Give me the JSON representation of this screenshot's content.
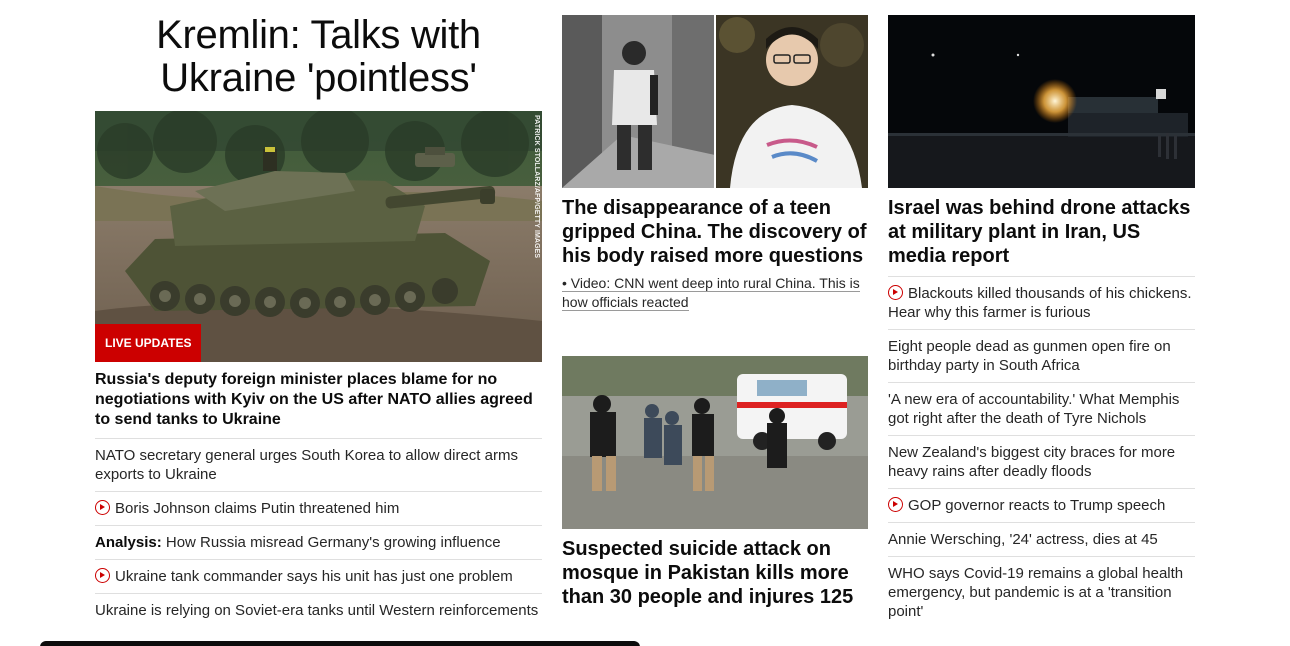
{
  "main": {
    "headline": "Kremlin: Talks with Ukraine 'pointless'",
    "badge": "LIVE UPDATES",
    "photo_credit": "PATRICK STOLLARZ/AFP/GETTY IMAGES",
    "lead": "Russia's deputy foreign minister places blame for no negotiations with Kyiv on the US after NATO allies agreed to send tanks to Ukraine",
    "items": [
      {
        "text": "NATO secretary general urges South Korea to allow direct arms exports to Ukraine"
      },
      {
        "text": "Boris Johnson claims Putin threatened him",
        "icon": "play-icon"
      },
      {
        "prefix": "Analysis:",
        "text": " How Russia misread Germany's growing influence"
      },
      {
        "text": "Ukraine tank commander says his unit has just one problem",
        "icon": "play-icon"
      },
      {
        "text": "Ukraine is relying on Soviet-era tanks until Western reinforcements"
      }
    ]
  },
  "center": {
    "story1_title": "The disappearance of a teen gripped China. The discovery of his body raised more questions",
    "story1_link": "• Video: CNN went deep into rural China. This is how officials reacted",
    "story2_title": "Suspected suicide attack on mosque in Pakistan kills more than 30 people and injures 125"
  },
  "right": {
    "title": "Israel was behind drone attacks at military plant in Iran, US media report",
    "items": [
      {
        "text": "Blackouts killed thousands of his chickens. Hear why this farmer is furious",
        "icon": "play-icon"
      },
      {
        "text": "Eight people dead as gunmen open fire on birthday party in South Africa"
      },
      {
        "text": "'A new era of accountability.' What Memphis got right after the death of Tyre Nichols"
      },
      {
        "text": "New Zealand's biggest city braces for more heavy rains after deadly floods"
      },
      {
        "text": "GOP governor reacts to Trump speech",
        "icon": "play-icon"
      },
      {
        "text": "Annie Wersching, '24' actress, dies at 45"
      },
      {
        "text": "WHO says Covid-19 remains a global health emergency, but pandemic is at a 'transition point'"
      }
    ]
  },
  "colors": {
    "accent": "#cc0000",
    "text": "#0c0c0c",
    "divider": "#dfdfdf"
  }
}
